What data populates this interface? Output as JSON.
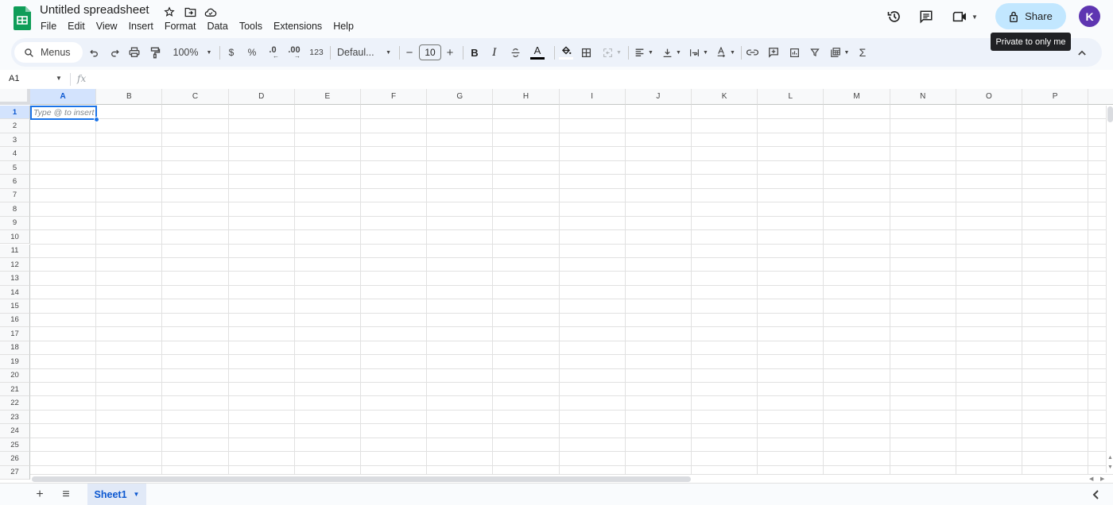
{
  "app": {
    "title": "Untitled spreadsheet",
    "brand_color": "#0f9d58",
    "icons": [
      "star-icon",
      "move-to-folder-icon",
      "cloud-saved-icon"
    ]
  },
  "menubar": [
    "File",
    "Edit",
    "View",
    "Insert",
    "Format",
    "Data",
    "Tools",
    "Extensions",
    "Help"
  ],
  "header_right": {
    "icons": [
      "version-history-icon",
      "comments-icon",
      "meet-icon"
    ],
    "share_label": "Share",
    "share_color": "#c2e7ff",
    "avatar_letter": "K",
    "avatar_color": "#5e35b1",
    "tooltip": "Private to only me"
  },
  "toolbar": {
    "search_label": "Menus",
    "zoom": "100%",
    "currency": "$",
    "percent": "%",
    "decrease_decimal": ".0",
    "increase_decimal": ".00",
    "more_formats": "123",
    "font": "Defaul...",
    "font_size": "10",
    "minus": "−",
    "plus": "+",
    "bold": "B",
    "italic": "I",
    "text_color_glyph": "A",
    "sum": "Σ"
  },
  "formula_bar": {
    "cell_ref": "A1",
    "fx": "fx",
    "value": ""
  },
  "grid": {
    "columns": [
      "A",
      "B",
      "C",
      "D",
      "E",
      "F",
      "G",
      "H",
      "I",
      "J",
      "K",
      "L",
      "M",
      "N",
      "O",
      "P"
    ],
    "rows": [
      "1",
      "2",
      "3",
      "4",
      "5",
      "6",
      "7",
      "8",
      "9",
      "10",
      "11",
      "12",
      "13",
      "14",
      "15",
      "16",
      "17",
      "18",
      "19",
      "20",
      "21",
      "22",
      "23",
      "24",
      "25",
      "26",
      "27"
    ],
    "selected_cell": "A1",
    "active_cell_placeholder": "Type @ to insert",
    "selection_color": "#1a73e8"
  },
  "sheetbar": {
    "add_label": "+",
    "all_sheets_label": "≡",
    "sheets": [
      "Sheet1"
    ],
    "active_sheet": "Sheet1"
  }
}
